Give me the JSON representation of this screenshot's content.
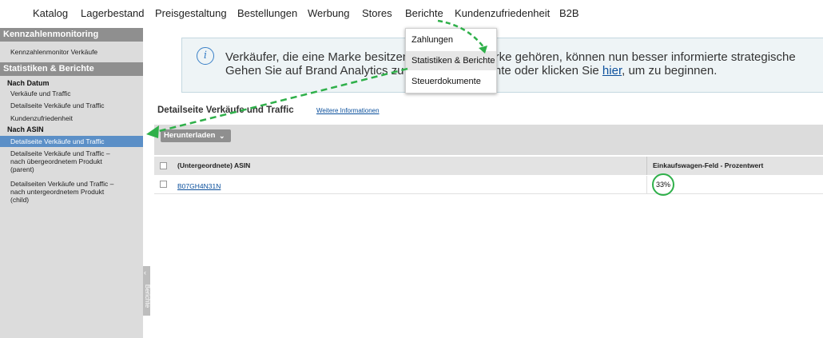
{
  "topnav": {
    "items": [
      "Katalog",
      "Lagerbestand",
      "Preisgestaltung",
      "Bestellungen",
      "Werbung",
      "Stores",
      "Berichte",
      "Kundenzufriedenheit",
      "B2B"
    ]
  },
  "dropdown": {
    "items": [
      "Zahlungen",
      "Statistiken & Berichte",
      "Steuerdokumente"
    ]
  },
  "sidebar": {
    "section1_title": "Kennzahlenmonitoring",
    "section1_link": "Kennzahlenmonitor Verkäufe",
    "section2_title": "Statistiken & Berichte",
    "group_date": "Nach Datum",
    "date_links": [
      "Verkäufe und Traffic",
      "Detailseite Verkäufe und Traffic",
      "Kundenzufriedenheit"
    ],
    "group_asin": "Nach ASIN",
    "asin_active": "Detailseite Verkäufe und Traffic",
    "asin_parent_lines": [
      "Detailseite Verkäufe und Traffic –",
      "nach übergeordnetem Produkt",
      "(parent)"
    ],
    "asin_child_lines": [
      "Detailseiten Verkäufe und Traffic –",
      "nach untergeordnetem Produkt",
      "(child)"
    ],
    "collapse_label": "Berichte"
  },
  "info": {
    "line1": "Verkäufer, die eine Marke besitzen, die zu ihrer Marke gehören, können nun besser informierte strategische",
    "line2_a": "Gehen Sie auf Brand Analytics zu dem Menü Berichte oder klicken Sie ",
    "line2_link": "hier",
    "line2_b": ", um zu beginnen."
  },
  "report": {
    "title": "Detailseite Verkäufe und Traffic",
    "more_info": "Weitere Informationen",
    "download_label": "Herunterladen"
  },
  "table": {
    "headers": [
      "(Untergeordnete) ASIN",
      "Einkaufswagen-Feld - Prozentwert"
    ],
    "rows": [
      {
        "asin": "B07GH4N31N",
        "buybox_pct": "33%"
      }
    ]
  },
  "colors": {
    "sidebar_active": "#5b8fc7",
    "annotation_green": "#2fb04a",
    "link": "#0a4f9c"
  }
}
